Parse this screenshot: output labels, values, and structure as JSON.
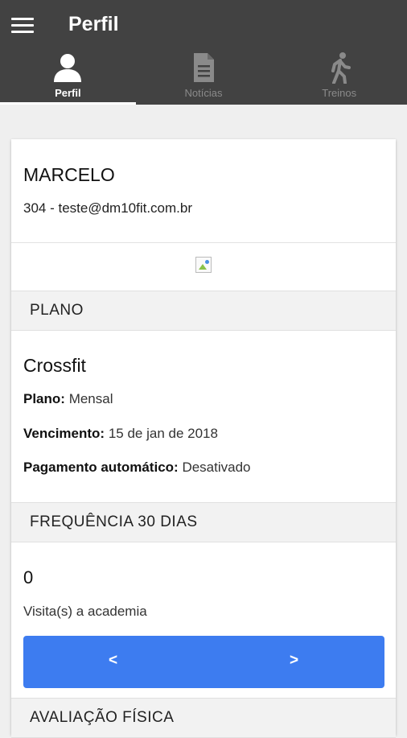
{
  "header": {
    "title": "Perfil"
  },
  "tabs": [
    {
      "label": "Perfil",
      "icon": "person-icon",
      "active": true
    },
    {
      "label": "Notícias",
      "icon": "document-icon",
      "active": false
    },
    {
      "label": "Treinos",
      "icon": "walking-icon",
      "active": false
    }
  ],
  "profile": {
    "name": "MARCELO",
    "id_email": "304 - teste@dm10fit.com.br"
  },
  "plan": {
    "section_title": "PLANO",
    "name": "Crossfit",
    "plan_label": "Plano:",
    "plan_value": "Mensal",
    "due_label": "Vencimento:",
    "due_value": "15 de jan de 2018",
    "autopay_label": "Pagamento automático:",
    "autopay_value": "Desativado"
  },
  "frequency": {
    "section_title": "FREQUÊNCIA 30 DIAS",
    "count": "0",
    "label": "Visita(s) a academia",
    "prev": "<",
    "next": ">"
  },
  "evaluation": {
    "section_title": "AVALIAÇÃO FÍSICA"
  },
  "colors": {
    "appbar": "#424242",
    "accent": "#3d7cf0"
  }
}
